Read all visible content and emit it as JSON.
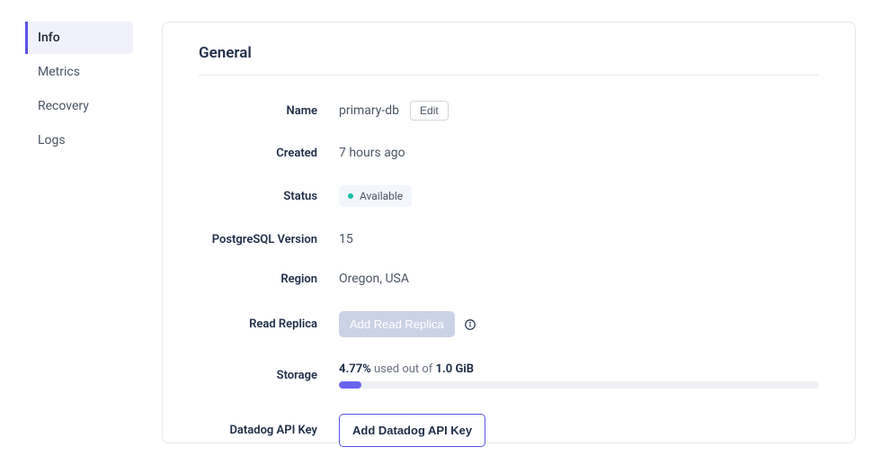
{
  "sidebar": {
    "items": [
      {
        "label": "Info"
      },
      {
        "label": "Metrics"
      },
      {
        "label": "Recovery"
      },
      {
        "label": "Logs"
      }
    ]
  },
  "section": {
    "title": "General"
  },
  "fields": {
    "name": {
      "label": "Name",
      "value": "primary-db",
      "edit": "Edit"
    },
    "created": {
      "label": "Created",
      "value": "7 hours ago"
    },
    "status": {
      "label": "Status",
      "value": "Available"
    },
    "pgversion": {
      "label": "PostgreSQL Version",
      "value": "15"
    },
    "region": {
      "label": "Region",
      "value": "Oregon, USA"
    },
    "replica": {
      "label": "Read Replica",
      "button": "Add Read Replica"
    },
    "storage": {
      "label": "Storage",
      "percent": "4.77%",
      "used_text": " used out of ",
      "total": "1.0 GiB"
    },
    "datadog": {
      "label": "Datadog API Key",
      "button": "Add Datadog API Key"
    }
  }
}
